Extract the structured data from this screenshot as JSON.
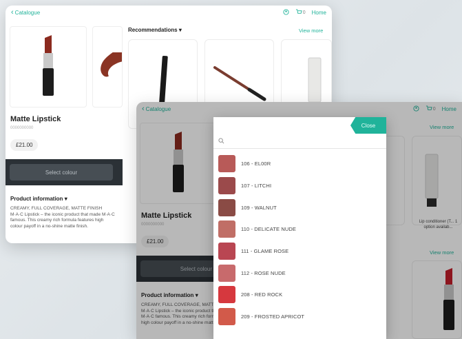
{
  "back_screen": {
    "nav": {
      "back_label": "Catalogue",
      "bag_count": "0",
      "home_label": "Home"
    },
    "product": {
      "name": "Matte Lipstick",
      "code": "0000000000",
      "price": "£21.00",
      "select_colour_label": "Select colour",
      "info_heading": "Product information",
      "info_text": "CREAMY, FULL COVERAGE, MATTE FINISH M·A·C Lipstick – the iconic product that made M·A·C famous. This creamy rich formula features high colour payoff in a no-shine matte finish."
    },
    "recommendations": {
      "heading": "Recommendations",
      "view_more_label": "View more"
    }
  },
  "front_screen": {
    "nav": {
      "back_label": "Catalogue",
      "bag_count": "0",
      "home_label": "Home"
    },
    "product": {
      "name": "Matte Lipstick",
      "code": "0000000000",
      "price": "£21.00",
      "select_colour_label": "Select colour",
      "info_heading": "Product information",
      "info_text": "CREAMY, FULL COVERAGE, MATTE FINISH M·A·C Lipstick – the iconic product that made M·A·C famous. This creamy rich formula features high colour payoff in a no-shine matte finish."
    },
    "view_more_label": "View more",
    "card_caption": "Lip conditioner (T... 1 option availab..."
  },
  "colour_picker": {
    "close_label": "Close",
    "search_placeholder": "",
    "shades": [
      {
        "label": "106 - EL00R",
        "color": "#b85a58"
      },
      {
        "label": "107 - LITCHI",
        "color": "#9b4a4b"
      },
      {
        "label": "109 - WALNUT",
        "color": "#8a4b45"
      },
      {
        "label": "110 - DELICATE NUDE",
        "color": "#c06e66"
      },
      {
        "label": "111 - GLAME ROSE",
        "color": "#b94652"
      },
      {
        "label": "112 - ROSE NUDE",
        "color": "#c86a6c"
      },
      {
        "label": "208 - RED ROCK",
        "color": "#d6383e"
      },
      {
        "label": "209 - FROSTED APRICOT",
        "color": "#d25a4a"
      }
    ]
  },
  "colors": {
    "accent": "#20b39a",
    "dark_bar": "#2b3136"
  },
  "icons": [
    "back-chevron-icon",
    "profile-icon",
    "bag-icon",
    "search-icon",
    "dropdown-caret-icon"
  ]
}
